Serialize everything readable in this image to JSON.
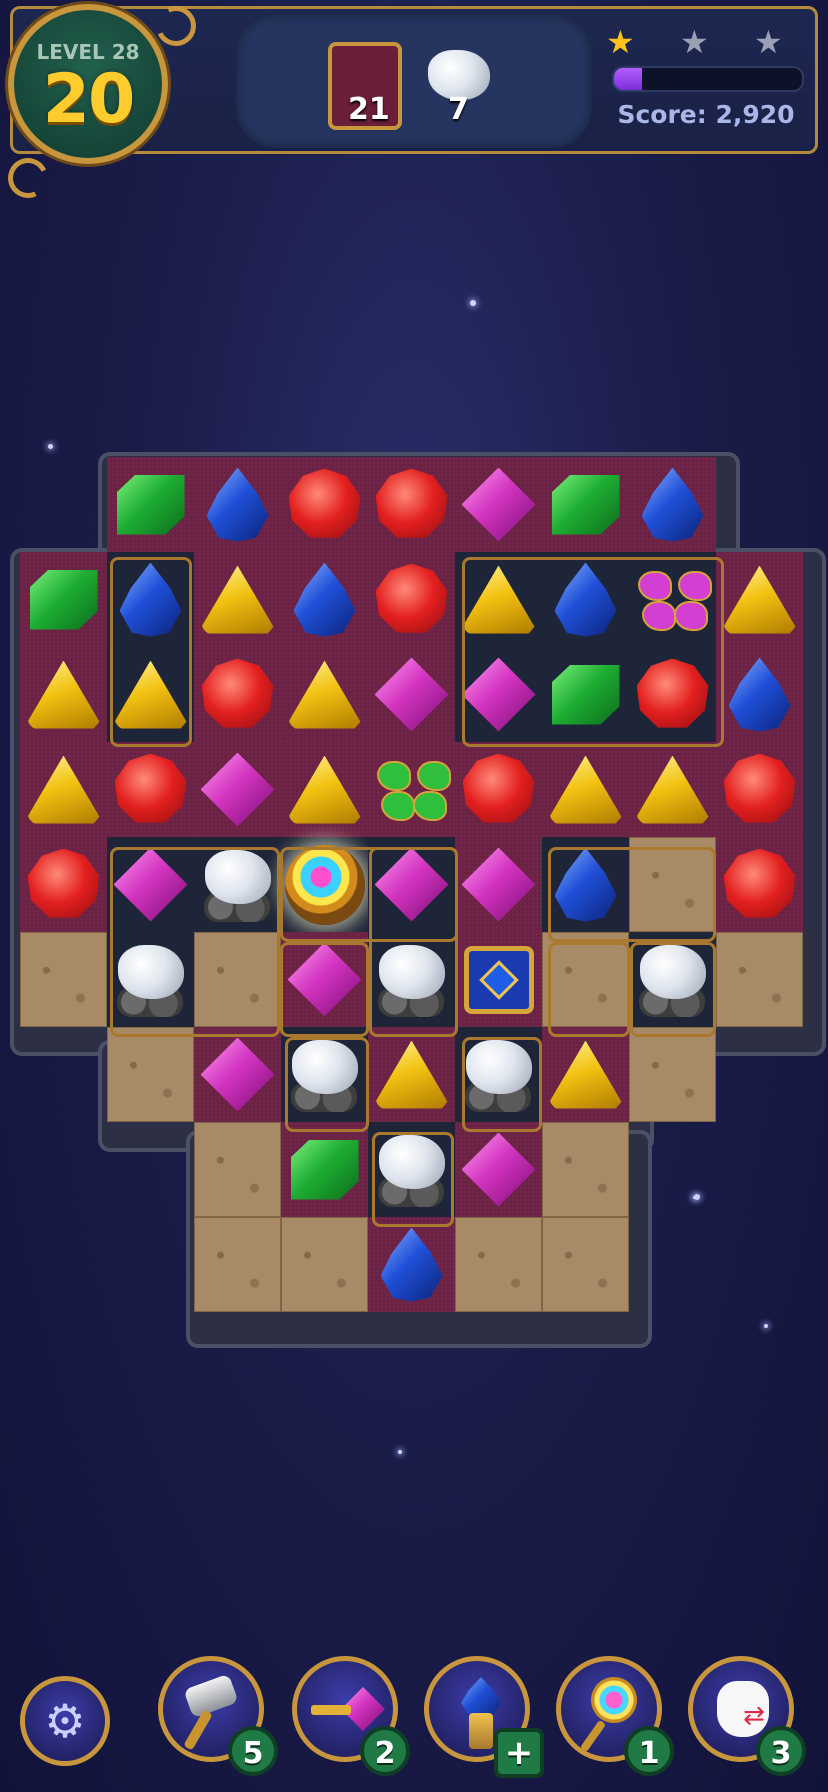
{
  "hud": {
    "level_label": "LEVEL 28",
    "moves_left": "20",
    "goal_tile_count": "21",
    "goal_diamond_count": "7",
    "stars": [
      "filled",
      "empty",
      "empty"
    ],
    "score_text": "Score: 2,920",
    "progress_fraction": 0.15
  },
  "colors": {
    "accent_gold": "#c8963d",
    "board_tile": "#6c2244",
    "progress_purple": "#9a45f0"
  },
  "board": {
    "gem_types": [
      "green-emerald",
      "blue-sapphire",
      "red-ruby",
      "yellow-topaz",
      "purple-amethyst",
      "white-diamond",
      "butterfly",
      "rainbow-bomb",
      "treasure-chest"
    ]
  },
  "boosters": [
    {
      "name": "hammer",
      "count": "5"
    },
    {
      "name": "arrow-gem",
      "count": "2"
    },
    {
      "name": "crystal-totem",
      "count": "+"
    },
    {
      "name": "magic-wand",
      "count": "1"
    },
    {
      "name": "swap-hand",
      "count": "3"
    }
  ],
  "settings_icon": "gear-icon"
}
